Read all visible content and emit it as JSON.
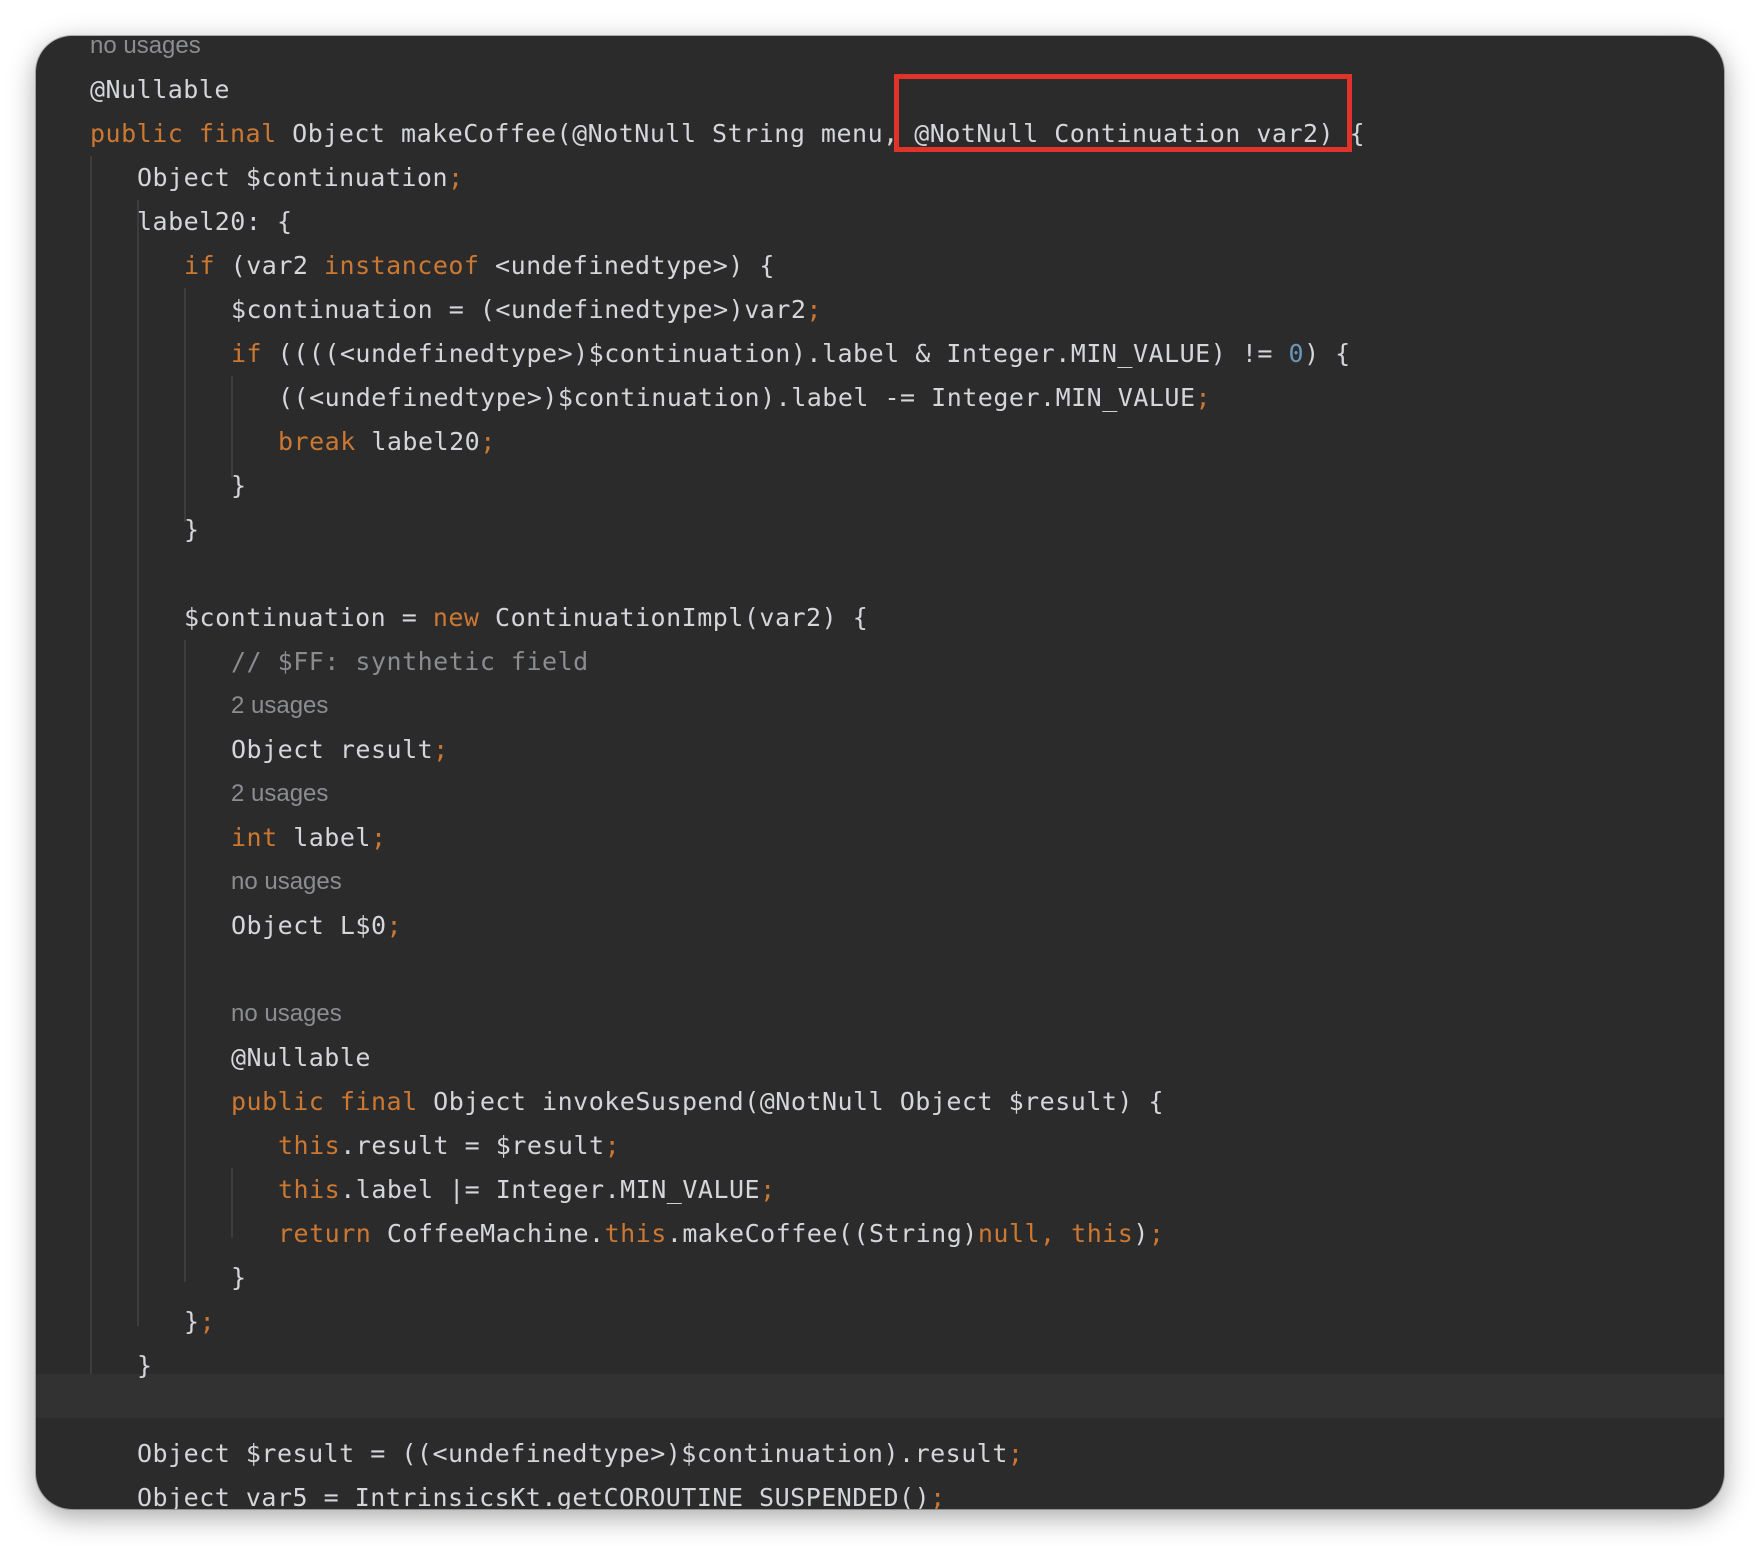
{
  "editor": {
    "theme": {
      "background": "#2b2b2b",
      "text": "#d4d6db",
      "keyword": "#cc7832",
      "number": "#6897bb",
      "comment": "#8a8c8f",
      "highlight_box": "#e0332a"
    },
    "highlighted_text": "@NotNull Continuation var2)",
    "lines": [
      {
        "kind": "hint",
        "text": "no usages"
      },
      {
        "kind": "code",
        "tokens": [
          {
            "t": "@Nullable"
          }
        ]
      },
      {
        "kind": "code",
        "tokens": [
          {
            "t": "public final",
            "c": "k"
          },
          {
            "t": " Object makeCoffee(@NotNull String menu, @NotNull Continuation var2) {"
          }
        ]
      },
      {
        "kind": "code",
        "tokens": [
          {
            "t": "Object $continuation"
          },
          {
            "t": ";",
            "c": "p"
          }
        ]
      },
      {
        "kind": "code",
        "tokens": [
          {
            "t": "label20: {"
          }
        ]
      },
      {
        "kind": "code",
        "tokens": [
          {
            "t": "if",
            "c": "k"
          },
          {
            "t": " (var2 "
          },
          {
            "t": "instanceof",
            "c": "k"
          },
          {
            "t": " <undefinedtype>) {"
          }
        ]
      },
      {
        "kind": "code",
        "tokens": [
          {
            "t": "$continuation = (<undefinedtype>)var2"
          },
          {
            "t": ";",
            "c": "p"
          }
        ]
      },
      {
        "kind": "code",
        "tokens": [
          {
            "t": "if",
            "c": "k"
          },
          {
            "t": " ((((<undefinedtype>)$continuation).label & Integer.MIN_VALUE) != "
          },
          {
            "t": "0",
            "c": "n"
          },
          {
            "t": ") {"
          }
        ]
      },
      {
        "kind": "code",
        "tokens": [
          {
            "t": "((<undefinedtype>)$continuation).label -= Integer.MIN_VALUE"
          },
          {
            "t": ";",
            "c": "p"
          }
        ]
      },
      {
        "kind": "code",
        "tokens": [
          {
            "t": "break",
            "c": "k"
          },
          {
            "t": " label20"
          },
          {
            "t": ";",
            "c": "p"
          }
        ]
      },
      {
        "kind": "code",
        "tokens": [
          {
            "t": "}"
          }
        ]
      },
      {
        "kind": "code",
        "tokens": [
          {
            "t": "}"
          }
        ]
      },
      {
        "kind": "blank"
      },
      {
        "kind": "code",
        "tokens": [
          {
            "t": "$continuation = "
          },
          {
            "t": "new",
            "c": "k"
          },
          {
            "t": " ContinuationImpl(var2) {"
          }
        ]
      },
      {
        "kind": "code",
        "tokens": [
          {
            "t": "// $FF: synthetic field",
            "c": "c"
          }
        ]
      },
      {
        "kind": "hint",
        "text": "2 usages"
      },
      {
        "kind": "code",
        "tokens": [
          {
            "t": "Object result"
          },
          {
            "t": ";",
            "c": "p"
          }
        ]
      },
      {
        "kind": "hint",
        "text": "2 usages"
      },
      {
        "kind": "code",
        "tokens": [
          {
            "t": "int",
            "c": "k"
          },
          {
            "t": " label"
          },
          {
            "t": ";",
            "c": "p"
          }
        ]
      },
      {
        "kind": "hint",
        "text": "no usages"
      },
      {
        "kind": "code",
        "tokens": [
          {
            "t": "Object L$0"
          },
          {
            "t": ";",
            "c": "p"
          }
        ]
      },
      {
        "kind": "blank"
      },
      {
        "kind": "hint",
        "text": "no usages"
      },
      {
        "kind": "code",
        "tokens": [
          {
            "t": "@Nullable"
          }
        ]
      },
      {
        "kind": "code",
        "tokens": [
          {
            "t": "public final",
            "c": "k"
          },
          {
            "t": " Object invokeSuspend(@NotNull Object $result) {"
          }
        ]
      },
      {
        "kind": "code",
        "tokens": [
          {
            "t": "this",
            "c": "k"
          },
          {
            "t": ".result = $result"
          },
          {
            "t": ";",
            "c": "p"
          }
        ]
      },
      {
        "kind": "code",
        "tokens": [
          {
            "t": "this",
            "c": "k"
          },
          {
            "t": ".label |= Integer.MIN_VALUE"
          },
          {
            "t": ";",
            "c": "p"
          }
        ]
      },
      {
        "kind": "code",
        "tokens": [
          {
            "t": "return",
            "c": "k"
          },
          {
            "t": " CoffeeMachine."
          },
          {
            "t": "this",
            "c": "k"
          },
          {
            "t": ".makeCoffee((String)"
          },
          {
            "t": "null, this",
            "c": "k"
          },
          {
            "t": ")"
          },
          {
            "t": ";",
            "c": "p"
          }
        ]
      },
      {
        "kind": "code",
        "tokens": [
          {
            "t": "}"
          }
        ]
      },
      {
        "kind": "code",
        "tokens": [
          {
            "t": "}"
          },
          {
            "t": ";",
            "c": "p"
          }
        ]
      },
      {
        "kind": "code",
        "tokens": [
          {
            "t": "}"
          }
        ]
      },
      {
        "kind": "blank"
      },
      {
        "kind": "code",
        "tokens": [
          {
            "t": "Object $result = ((<undefinedtype>)$continuation).result"
          },
          {
            "t": ";",
            "c": "p"
          }
        ]
      },
      {
        "kind": "code",
        "tokens": [
          {
            "t": "Object var5 = IntrinsicsKt.getCOROUTINE_SUSPENDED()"
          },
          {
            "t": ";",
            "c": "p"
          }
        ]
      }
    ]
  }
}
